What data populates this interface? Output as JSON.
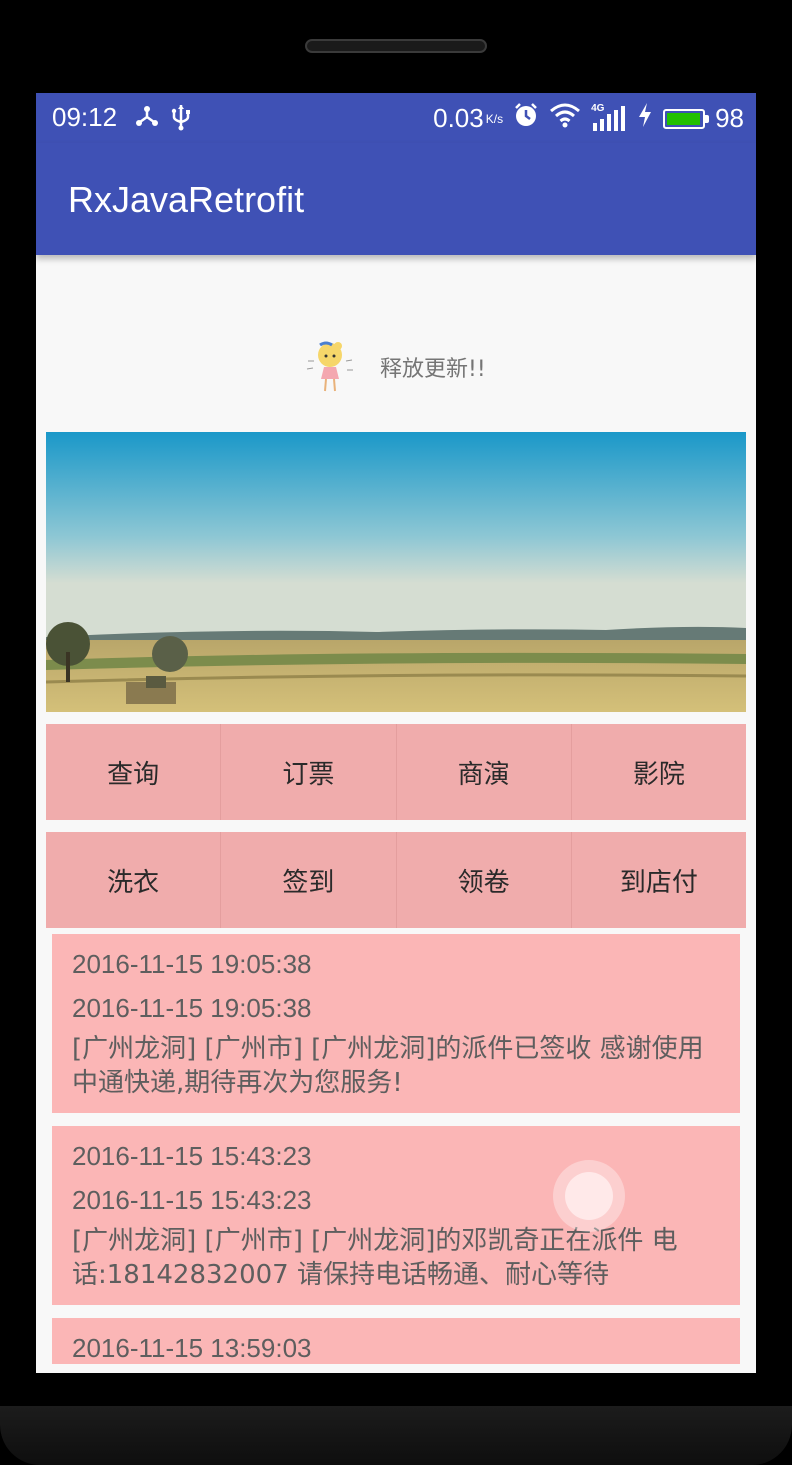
{
  "status_bar": {
    "time": "09:12",
    "network_speed": "0.03",
    "speed_unit": "K/s",
    "network_type": "4G",
    "battery_level": "98",
    "battery_fraction": 0.98,
    "battery_color": "#22c000",
    "left_icons": [
      "usb-tether-icon",
      "usb-icon"
    ],
    "right_icons": [
      "alarm-icon",
      "wifi-icon",
      "signal-icon",
      "charging-icon",
      "battery-icon"
    ]
  },
  "app_bar": {
    "title": "RxJavaRetrofit",
    "color": "#3f51b5"
  },
  "pull_refresh": {
    "text": "释放更新!!",
    "icon": "cartoon-girl-icon"
  },
  "banner": {
    "icon": "farm-landscape-image"
  },
  "menu": {
    "row1": [
      "查询",
      "订票",
      "商演",
      "影院"
    ],
    "row2": [
      "洗衣",
      "签到",
      "领卷",
      "到店付"
    ]
  },
  "records": [
    {
      "time1": "2016-11-15 19:05:38",
      "time2": "2016-11-15 19:05:38",
      "desc": "[广州龙洞] [广州市] [广州龙洞]的派件已签收 感谢使用中通快递,期待再次为您服务!"
    },
    {
      "time1": "2016-11-15 15:43:23",
      "time2": "2016-11-15 15:43:23",
      "desc": "[广州龙洞] [广州市] [广州龙洞]的邓凯奇正在派件 电话:18142832007 请保持电话畅通、耐心等待"
    },
    {
      "time1": "2016-11-15 13:59:03"
    }
  ]
}
